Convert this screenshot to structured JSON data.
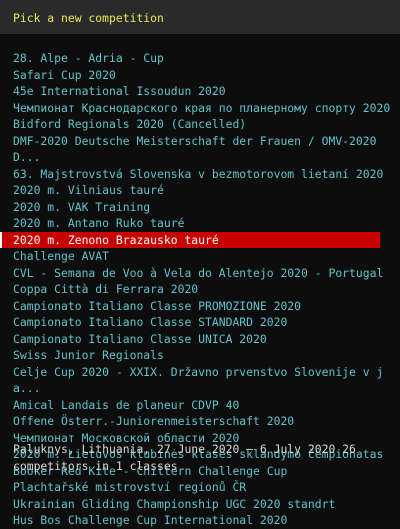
{
  "header": {
    "title": "Pick a new competition"
  },
  "competitions": [
    "28. Alpe - Adria - Cup",
    "Safari Cup 2020",
    "45e International Issoudun 2020",
    "Чемпионат Краснодарского края по планерному спорту 2020",
    "Bidford Regionals 2020 (Cancelled)",
    "DMF-2020 Deutsche Meisterschaft der Frauen / OMV-2020 D...",
    "63. Majstrovstvá Slovenska v bezmotorovom lietaní 2020",
    "2020 m. Vilniaus tauré",
    "2020 m. VAK Training",
    "2020 m. Antano Ruko tauré",
    "2020 m. Zenono Brazausko tauré",
    "Challenge AVAT",
    "CVL - Semana de Voo à Vela do Alentejo 2020 - Portugal",
    "Coppa Città di Ferrara 2020",
    "Campionato Italiano Classe PROMOZIONE 2020",
    "Campionato Italiano Classe STANDARD 2020",
    "Campionato Italiano Classe UNICA 2020",
    "Swiss Junior Regionals",
    "Celje Cup 2020 - XXIX. Državno prvenstvo Slovenije v ja...",
    "Amical Landais de planeur CDVP 40",
    "Offene Österr.-Juniorenmeisterschaft 2020",
    "Чемпионат Московской области 2020",
    "2020 m. Lietuvos klubinės klasės sklandymo čempionatas",
    "Booker Red Kite - Chiltern Challenge Cup",
    "Plachtařské mistrovství regionů ČR",
    "Ukrainian Gliding Championship UGC 2020 standrt",
    "Hus Bos Challenge Cup International 2020"
  ],
  "selected_index": 10,
  "footer": {
    "info": "Paluknys, Lithuania, 27 June 2020 – 6 July 2020 26 competitors in 1 classes"
  },
  "colors": {
    "background": "#0d0d0d",
    "header_bg": "#2a2a2a",
    "header_text": "#e8e85a",
    "item_text": "#62c3cc",
    "selected_bg": "#c80000",
    "selected_text": "#ffffff",
    "footer_text": "#d8d8d8"
  }
}
